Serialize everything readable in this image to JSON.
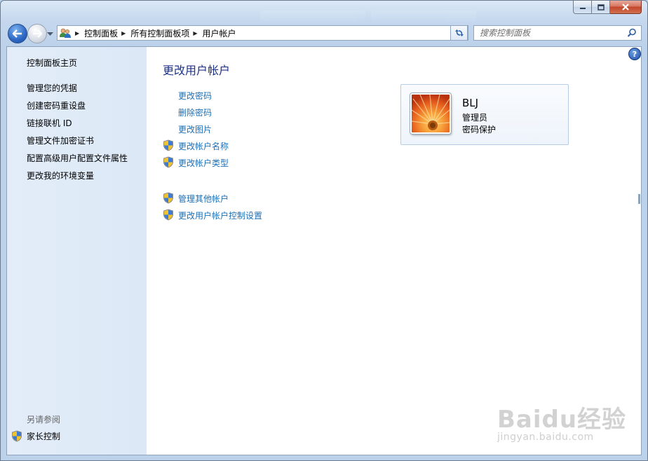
{
  "breadcrumb": {
    "items": [
      "控制面板",
      "所有控制面板项",
      "用户帐户"
    ]
  },
  "search": {
    "placeholder": "搜索控制面板"
  },
  "sidebar": {
    "items": [
      {
        "label": "控制面板主页"
      },
      {
        "label": "管理您的凭据"
      },
      {
        "label": "创建密码重设盘"
      },
      {
        "label": "链接联机 ID"
      },
      {
        "label": "管理文件加密证书"
      },
      {
        "label": "配置高级用户配置文件属性"
      },
      {
        "label": "更改我的环境变量"
      }
    ],
    "see_also_title": "另请参阅",
    "see_also_items": [
      {
        "label": "家长控制",
        "icon": "uac-shield-icon"
      }
    ]
  },
  "main": {
    "title": "更改用户帐户",
    "tasks": [
      {
        "label": "更改密码",
        "shield": false
      },
      {
        "label": "删除密码",
        "shield": false
      },
      {
        "label": "更改图片",
        "shield": false
      },
      {
        "label": "更改帐户名称",
        "shield": true
      },
      {
        "label": "更改帐户类型",
        "shield": true
      }
    ],
    "other_tasks": [
      {
        "label": "管理其他帐户",
        "shield": true
      },
      {
        "label": "更改用户帐户控制设置",
        "shield": true
      }
    ]
  },
  "account": {
    "name": "BLJ",
    "role": "管理员",
    "password_status": "密码保护",
    "avatar": "orange-flower-picture"
  },
  "help": {
    "label": "?"
  },
  "watermark": {
    "main": "Baidu经验",
    "sub": "jingyan.baidu.com"
  },
  "colors": {
    "link": "#1e6fb5",
    "title": "#1e3287",
    "sidebar_bg": "#dce8f6"
  }
}
